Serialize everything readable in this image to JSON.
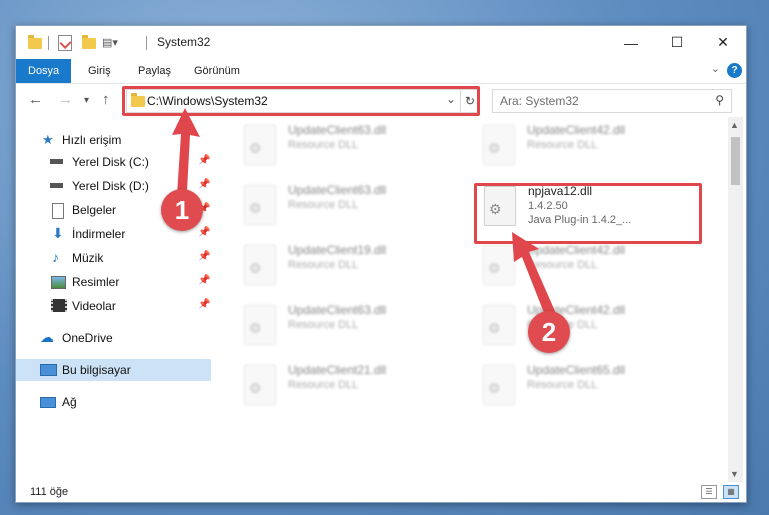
{
  "window": {
    "title": "System32",
    "controls": {
      "minimize": "—",
      "maximize": "☐",
      "close": "✕"
    }
  },
  "ribbon": {
    "tabs": [
      "Dosya",
      "Giriş",
      "Paylaş",
      "Görünüm"
    ],
    "active_tab": "Dosya",
    "help_label": "?",
    "expand_label": "⌄"
  },
  "address": {
    "path": "C:\\Windows\\System32",
    "search_placeholder": "Ara: System32"
  },
  "sidebar": {
    "items": [
      {
        "label": "Hızlı erişim",
        "icon": "star-icon",
        "pinned": false
      },
      {
        "label": "Yerel Disk (C:)",
        "icon": "drive-icon",
        "pinned": true
      },
      {
        "label": "Yerel Disk (D:)",
        "icon": "drive-icon",
        "pinned": true
      },
      {
        "label": "Belgeler",
        "icon": "documents-icon",
        "pinned": true
      },
      {
        "label": "İndirmeler",
        "icon": "download-icon",
        "pinned": true
      },
      {
        "label": "Müzik",
        "icon": "music-icon",
        "pinned": true
      },
      {
        "label": "Resimler",
        "icon": "pictures-icon",
        "pinned": true
      },
      {
        "label": "Videolar",
        "icon": "video-icon",
        "pinned": true
      },
      {
        "label": "OneDrive",
        "icon": "cloud-icon",
        "pinned": false
      },
      {
        "label": "Bu bilgisayar",
        "icon": "computer-icon",
        "pinned": false,
        "selected": true
      },
      {
        "label": "Ağ",
        "icon": "network-icon",
        "pinned": false
      }
    ]
  },
  "files": {
    "left_column": [
      {
        "name": "UpdateClient63.dll",
        "type": "Resource DLL"
      },
      {
        "name": "UpdateClient63.dll",
        "type": "Resource DLL"
      },
      {
        "name": "UpdateClient19.dll",
        "type": "Resource DLL"
      },
      {
        "name": "UpdateClient63.dll",
        "type": "Resource DLL"
      },
      {
        "name": "UpdateClient21.dll",
        "type": "Resource DLL"
      }
    ],
    "right_column": [
      {
        "name": "UpdateClient42.dll",
        "type": "Resource DLL"
      },
      {
        "name": "npjava12.dll",
        "version": "1.4.2.50",
        "type": "Java Plug-in 1.4.2_...",
        "highlighted": true
      },
      {
        "name": "UpdateClient42.dll",
        "type": "Resource DLL"
      },
      {
        "name": "UpdateClient42.dll",
        "type": "Resource DLL"
      },
      {
        "name": "UpdateClient65.dll",
        "type": "Resource DLL"
      }
    ]
  },
  "status": {
    "item_count": "111 öğe"
  },
  "annotations": {
    "step1": "1",
    "step2": "2",
    "color": "#e0474c"
  }
}
